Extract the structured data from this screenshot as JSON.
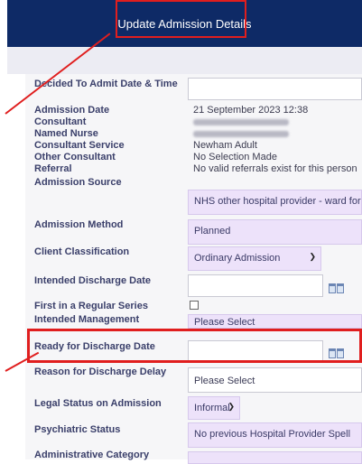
{
  "header": {
    "title": "Update Admission Details"
  },
  "form": {
    "decided_to_admit": {
      "label": "Decided To Admit Date & Time",
      "value": ""
    },
    "admission_date": {
      "label": "Admission Date",
      "value": "21 September 2023 12:38"
    },
    "consultant": {
      "label": "Consultant"
    },
    "named_nurse": {
      "label": "Named Nurse"
    },
    "consultant_service": {
      "label": "Consultant Service",
      "value": "Newham Adult"
    },
    "other_consultant": {
      "label": "Other Consultant",
      "value": "No Selection Made"
    },
    "referral": {
      "label": "Referral",
      "value": "No valid referrals exist for this person"
    },
    "admission_source": {
      "label": "Admission Source",
      "value": "NHS other hospital provider - ward for"
    },
    "admission_method": {
      "label": "Admission Method",
      "value": "Planned"
    },
    "client_classification": {
      "label": "Client Classification",
      "value": "Ordinary Admission"
    },
    "intended_discharge_date": {
      "label": "Intended Discharge Date",
      "value": ""
    },
    "first_regular_series": {
      "label": "First in a Regular Series"
    },
    "intended_management": {
      "label": "Intended Management",
      "value": "Please Select"
    },
    "ready_for_discharge": {
      "label": "Ready for Discharge Date",
      "value": ""
    },
    "reason_discharge_delay": {
      "label": "Reason for Discharge Delay",
      "value": "Please Select"
    },
    "legal_status": {
      "label": "Legal Status on Admission",
      "value": "Informal"
    },
    "psychiatric_status": {
      "label": "Psychiatric Status",
      "value": "No previous Hospital Provider Spell"
    },
    "administrative_category": {
      "label": "Administrative Category"
    }
  },
  "icons": {
    "calendar": "calendar-icon",
    "dropdown": "chevron-down-icon"
  },
  "colors": {
    "header_bg": "#0e2a66",
    "highlight": "#e01e1e",
    "select_bg": "#ede2fa"
  }
}
